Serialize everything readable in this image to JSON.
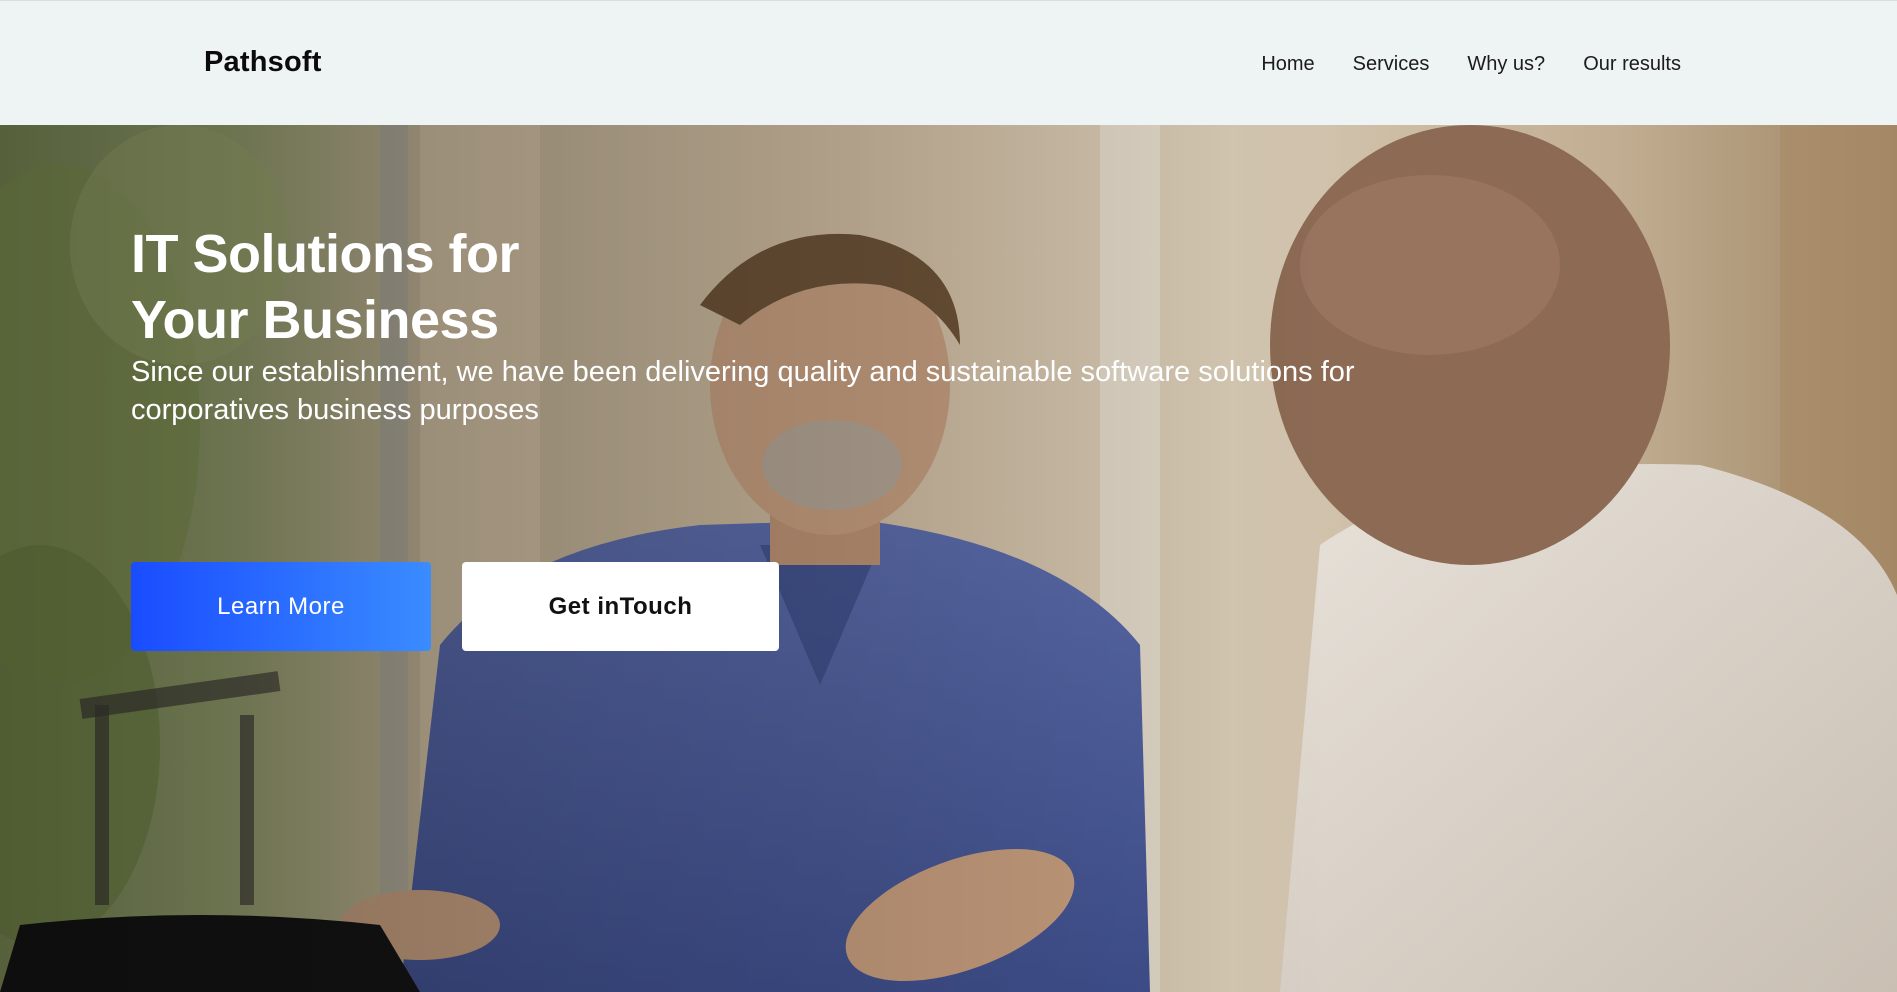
{
  "brand": {
    "name": "Pathsoft"
  },
  "nav": {
    "items": [
      {
        "label": "Home"
      },
      {
        "label": "Services"
      },
      {
        "label": "Why us?"
      },
      {
        "label": "Our results"
      }
    ]
  },
  "hero": {
    "title": "IT Solutions for\nYour Business",
    "subtitle": "Since our establishment, we have been delivering quality and sustainable software solutions for corporatives business purposes",
    "primary_button": "Learn More",
    "secondary_button": "Get inTouch"
  },
  "colors": {
    "navbar_bg": "#eef3f3",
    "primary_gradient_start": "#1a4cff",
    "primary_gradient_end": "#3a8cff"
  }
}
